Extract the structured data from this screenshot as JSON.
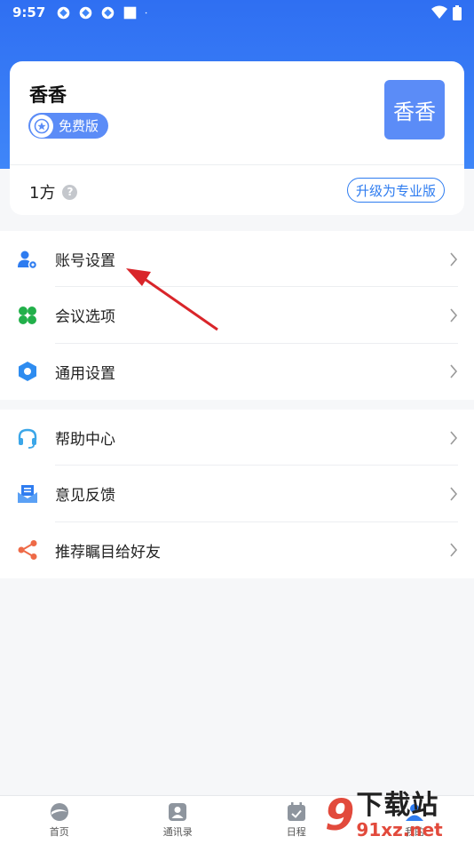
{
  "status": {
    "time": "9:57",
    "icons": [
      "app-icon",
      "app-icon",
      "app-icon",
      "square-icon",
      "dot-icon"
    ],
    "right_icons": [
      "wifi-icon",
      "battery-icon"
    ]
  },
  "profile": {
    "name": "香香",
    "plan_badge": "免费版",
    "avatar_text": "香香",
    "quota": "1方",
    "help_icon": "?",
    "upgrade_label": "升级为专业版"
  },
  "menu_group_1": [
    {
      "label": "账号设置",
      "icon": "account-settings-icon"
    },
    {
      "label": "会议选项",
      "icon": "clover-icon"
    },
    {
      "label": "通用设置",
      "icon": "hexagon-gear-icon"
    }
  ],
  "menu_group_2": [
    {
      "label": "帮助中心",
      "icon": "headset-icon"
    },
    {
      "label": "意见反馈",
      "icon": "feedback-icon"
    },
    {
      "label": "推荐瞩目给好友",
      "icon": "share-icon"
    }
  ],
  "tabs": [
    {
      "label": "首页"
    },
    {
      "label": "通讯录"
    },
    {
      "label": "日程"
    },
    {
      "label": "我的"
    }
  ],
  "watermark": {
    "number": "9",
    "cn": "下载站",
    "url": "91xz.net"
  },
  "colors": {
    "header": "#3f86f8",
    "accent": "#2e7cf0",
    "badge": "#5b8cf7",
    "arrow": "#d9252a"
  }
}
